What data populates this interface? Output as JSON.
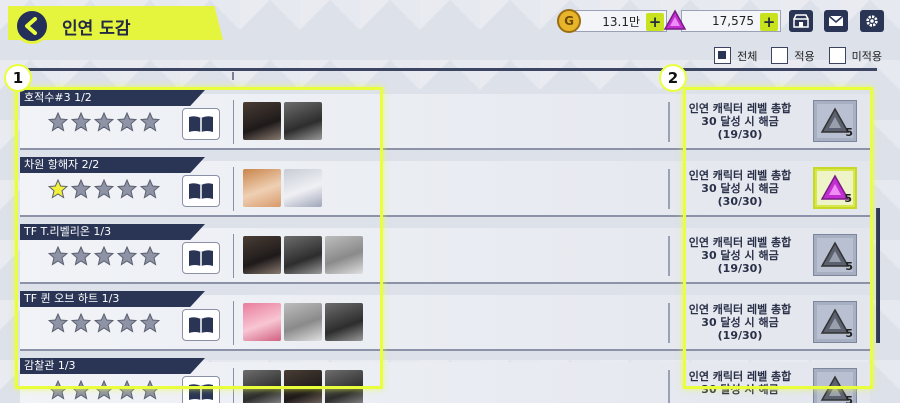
{
  "header": {
    "title": "인연 도감",
    "gold": "13.1만",
    "gems": "17,575"
  },
  "filters": [
    {
      "label": "전체",
      "checked": true
    },
    {
      "label": "적용",
      "checked": false
    },
    {
      "label": "미적용",
      "checked": false
    }
  ],
  "badges": {
    "left": "1",
    "right": "2"
  },
  "rows": [
    {
      "name": "호적수#3  1/2",
      "stars_filled": 0,
      "portraits": [
        "p-dark",
        "p-gray"
      ],
      "reward_text": "인연 캐릭터 레벨 총합\n30 달성 시 해금\n(19/30)",
      "reward_count": "5",
      "reward_active": false
    },
    {
      "name": "차원 항해자  2/2",
      "stars_filled": 1,
      "portraits": [
        "p-orange",
        "p-silver"
      ],
      "reward_text": "인연 캐릭터 레벨 총합\n30 달성 시 해금\n(30/30)",
      "reward_count": "5",
      "reward_active": true
    },
    {
      "name": "TF T.리벨리온  1/3",
      "stars_filled": 0,
      "portraits": [
        "p-dark",
        "p-gray",
        "p-light"
      ],
      "reward_text": "인연 캐릭터 레벨 총합\n30 달성 시 해금\n(19/30)",
      "reward_count": "5",
      "reward_active": false
    },
    {
      "name": "TF 퀸 오브 하트  1/3",
      "stars_filled": 0,
      "portraits": [
        "p-pink",
        "p-light",
        "p-gray"
      ],
      "reward_text": "인연 캐릭터 레벨 총합\n30 달성 시 해금\n(19/30)",
      "reward_count": "5",
      "reward_active": false
    },
    {
      "name": "감찰관  1/3",
      "stars_filled": 0,
      "portraits": [
        "p-gray",
        "p-dark",
        "p-gray"
      ],
      "reward_text": "인연 캐릭터 레벨 총합\n30 달성 시 해금",
      "reward_count": "5",
      "reward_active": false
    }
  ],
  "colors": {
    "accent": "#eaff3b",
    "navy": "#2a3556",
    "star_on": "#f2f03a",
    "star_off": "#8e93a5"
  }
}
